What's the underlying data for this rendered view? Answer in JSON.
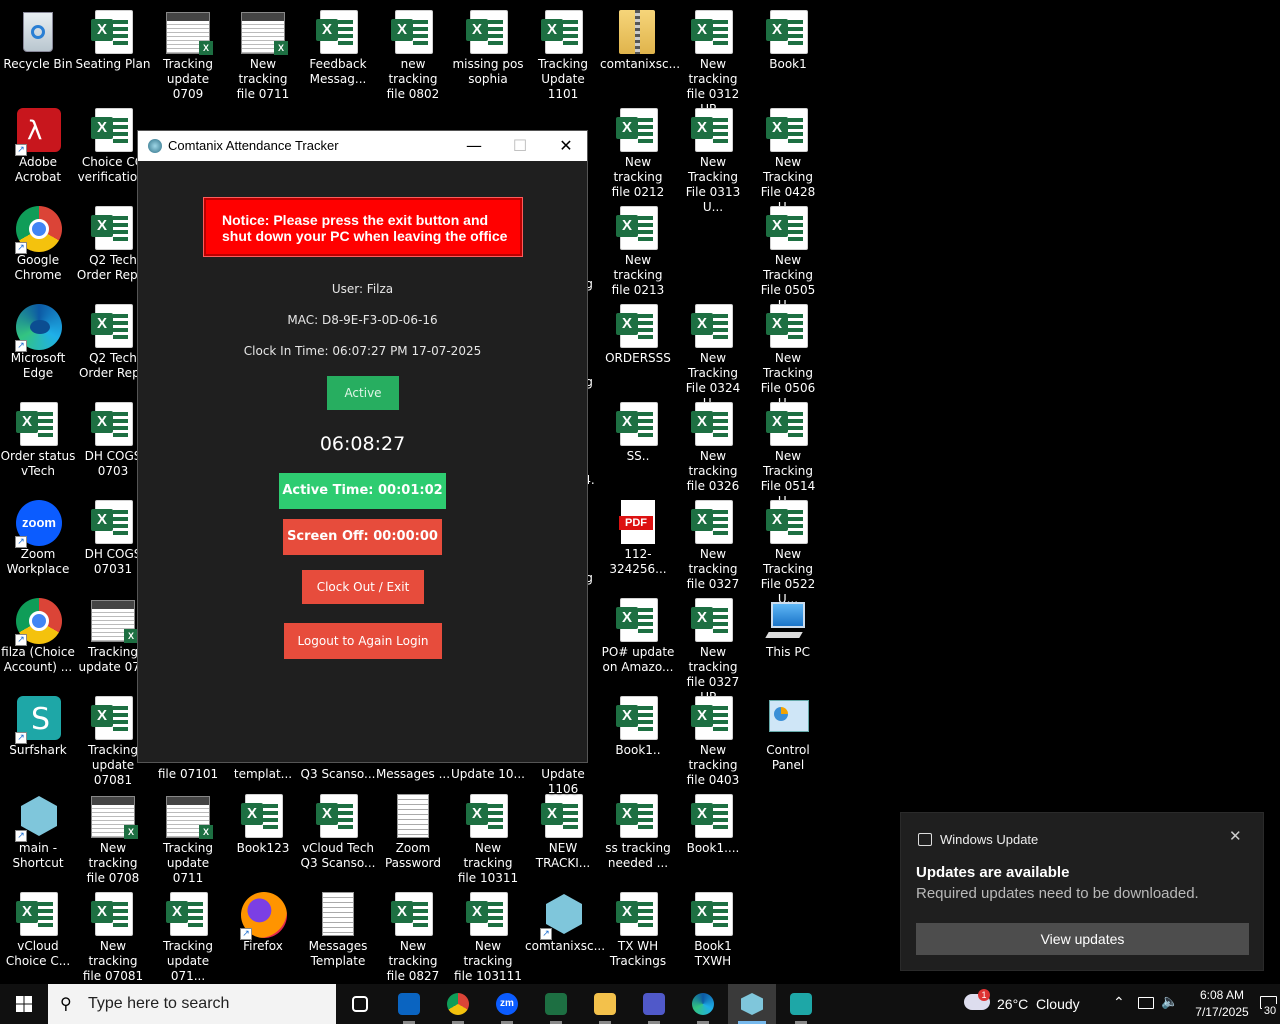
{
  "desktop": {
    "icons": [
      {
        "label": "Recycle Bin",
        "kind": "recycle"
      },
      {
        "label": "Seating Plan",
        "kind": "excel"
      },
      {
        "label": "Tracking\nupdate 0709",
        "kind": "thumb"
      },
      {
        "label": "New tracking\nfile 0711",
        "kind": "thumb"
      },
      {
        "label": "Feedback\nMessag...",
        "kind": "excel"
      },
      {
        "label": "new tracking\nfile 0802",
        "kind": "excel"
      },
      {
        "label": "missing pos\nsophia",
        "kind": "excel"
      },
      {
        "label": "Tracking\nUpdate 1101",
        "kind": "excel"
      },
      {
        "label": "comtanixsc...",
        "kind": "zip"
      },
      {
        "label": "New tracking\nfile 0312 UP...",
        "kind": "excel"
      },
      {
        "label": "Book1",
        "kind": "excel"
      },
      {
        "label": "Adobe\nAcrobat",
        "kind": "acrobat"
      },
      {
        "label": "Choice CO\nverificatio...",
        "kind": "excel"
      },
      {
        "label": "Google\nChrome",
        "kind": "chrome"
      },
      {
        "label": "Q2 Tech\nOrder Rep...",
        "kind": "excel"
      },
      {
        "label": "Microsoft\nEdge",
        "kind": "edge"
      },
      {
        "label": "Q2 Tech\nOrder Repo",
        "kind": "excel"
      },
      {
        "label": "Order status\nvTech",
        "kind": "excel"
      },
      {
        "label": "DH COGS\n0703",
        "kind": "excel"
      },
      {
        "label": "Zoom\nWorkplace",
        "kind": "zoom"
      },
      {
        "label": "DH COGS\n07031",
        "kind": "excel"
      },
      {
        "label": "filza (Choice\nAccount) ...",
        "kind": "chrome"
      },
      {
        "label": "Tracking\nupdate 070",
        "kind": "thumb"
      },
      {
        "label": "Surfshark",
        "kind": "surfshark"
      },
      {
        "label": "Tracking\nupdate 07081",
        "kind": "excel"
      },
      {
        "label": "main -\nShortcut",
        "kind": "comtanix"
      },
      {
        "label": "New tracking\nfile 0708",
        "kind": "thumb"
      },
      {
        "label": "Tracking\nupdate 0711",
        "kind": "thumb"
      },
      {
        "label": "Book123",
        "kind": "excel"
      },
      {
        "label": "vCloud Tech\nQ3 Scanso...",
        "kind": "excel"
      },
      {
        "label": "Zoom\nPassword",
        "kind": "doc"
      },
      {
        "label": "New tracking\nfile 10311",
        "kind": "excel"
      },
      {
        "label": "NEW\nTRACKI...",
        "kind": "excel"
      },
      {
        "label": "ss tracking\nneeded ...",
        "kind": "excel"
      },
      {
        "label": "Book1....",
        "kind": "excel"
      },
      {
        "label": "vCloud\nChoice C...",
        "kind": "excel"
      },
      {
        "label": "New tracking\nfile 07081",
        "kind": "excel"
      },
      {
        "label": "Tracking\nupdate 071...",
        "kind": "excel"
      },
      {
        "label": "Firefox",
        "kind": "firefox"
      },
      {
        "label": "Messages\nTemplate",
        "kind": "doc"
      },
      {
        "label": "New tracking\nfile 0827",
        "kind": "excel"
      },
      {
        "label": "New tracking\nfile 103111",
        "kind": "excel"
      },
      {
        "label": "comtanixsc...",
        "kind": "comtanix"
      },
      {
        "label": "TX WH\nTrackings",
        "kind": "excel"
      },
      {
        "label": "Book1 TXWH",
        "kind": "excel"
      },
      {
        "label": "New tracking\nfile 0212",
        "kind": "excel"
      },
      {
        "label": "New Tracking\nFile 0313 U...",
        "kind": "excel"
      },
      {
        "label": "New Tracking\nFile 0428 U...",
        "kind": "excel"
      },
      {
        "label": "New tracking\nfile 0213",
        "kind": "excel"
      },
      {
        "label": "New Tracking\nFile 0505 U...",
        "kind": "excel"
      },
      {
        "label": "ORDERSSS",
        "kind": "excel"
      },
      {
        "label": "New Tracking\nFile 0324 U...",
        "kind": "excel"
      },
      {
        "label": "New Tracking\nFile 0506 U...",
        "kind": "excel"
      },
      {
        "label": "SS..",
        "kind": "excel"
      },
      {
        "label": "New tracking\nfile 0326",
        "kind": "excel"
      },
      {
        "label": "New Tracking\nFile 0514 U...",
        "kind": "excel"
      },
      {
        "label": "112-324256...",
        "kind": "pdf"
      },
      {
        "label": "New tracking\nfile 0327",
        "kind": "excel"
      },
      {
        "label": "New Tracking\nFile 0522 U...",
        "kind": "excel"
      },
      {
        "label": "PO# update\non Amazo...",
        "kind": "excel"
      },
      {
        "label": "New tracking\nfile 0327 UP...",
        "kind": "excel"
      },
      {
        "label": "This PC",
        "kind": "thispc"
      },
      {
        "label": "Book1..",
        "kind": "excel"
      },
      {
        "label": "New tracking\nfile 0403",
        "kind": "excel"
      },
      {
        "label": "Control\nPanel",
        "kind": "controlpanel"
      },
      {
        "label": "file 07101",
        "kind": "partial"
      },
      {
        "label": "templat...",
        "kind": "partial"
      },
      {
        "label": "Q3 Scanso...",
        "kind": "partial"
      },
      {
        "label": "Messages ...",
        "kind": "partial"
      },
      {
        "label": "Update 10...",
        "kind": "partial"
      },
      {
        "label": "Update 1106",
        "kind": "partial"
      },
      {
        "label": "g",
        "kind": "partial"
      },
      {
        "label": "g",
        "kind": "partial"
      },
      {
        "label": "4.",
        "kind": "partial"
      },
      {
        "label": "g",
        "kind": "partial"
      }
    ],
    "pdf_badge": "PDF",
    "excel_glyph": "X",
    "zoom_glyph": "zoom"
  },
  "app": {
    "title": "Comtanix Attendance Tracker",
    "minimize": "—",
    "maximize": "☐",
    "close": "✕",
    "notice": "Notice: Please press the exit button and shut down your PC when leaving the office",
    "user": "User: Filza",
    "mac": "MAC: D8-9E-F3-0D-06-16",
    "clock_in": "Clock In Time: 06:07:27 PM 17-07-2025",
    "status": "Active",
    "clock": "06:08:27",
    "active_time": "Active Time: 00:01:02",
    "screen_off": "Screen Off: 00:00:00",
    "clock_out": "Clock Out / Exit",
    "logout": "Logout to Again Login"
  },
  "toast": {
    "app": "Windows Update",
    "close": "✕",
    "heading": "Updates are available",
    "body": "Required updates need to be downloaded.",
    "button": "View updates"
  },
  "taskbar": {
    "search_placeholder": "Type here to search",
    "apps": [
      "task-view",
      "outlook",
      "chrome",
      "zoom",
      "excel",
      "file-explorer",
      "teams",
      "edge",
      "comtanix",
      "surfshark"
    ],
    "zoom_glyph": "zm",
    "weather_badge": "1",
    "weather": "26°C  Cloudy",
    "time": "6:08 AM",
    "date": "7/17/2025",
    "notification_count": "30"
  },
  "colors": {
    "notice_red": "#ff0000",
    "active_green": "#27ae60",
    "active_time_green": "#2ecc71",
    "danger_red": "#e74c3c",
    "window_bg": "#1f1f1f",
    "excel_green": "#1d6f42"
  }
}
